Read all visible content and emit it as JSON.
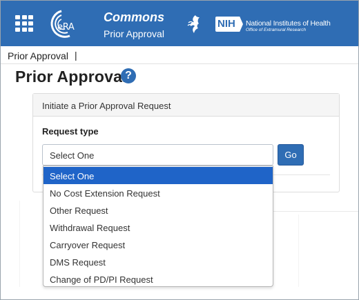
{
  "header": {
    "logo_text": "eRA",
    "app_title": "Commons",
    "app_subtitle": "Prior Approval",
    "nih_badge": "NIH",
    "nih_name": "National Institutes of Health",
    "nih_sub": "Office of Extramural Research",
    "brand_color": "#2f6db4"
  },
  "breadcrumb": {
    "label": "Prior Approval",
    "separator": "|"
  },
  "page": {
    "title": "Prior Approval",
    "help_symbol": "?"
  },
  "panel": {
    "heading": "Initiate a Prior Approval Request",
    "field_label": "Request type",
    "select_value": "Select One",
    "go_label": "Go"
  },
  "dropdown": {
    "options": [
      "Select One",
      "No Cost Extension Request",
      "Other Request",
      "Withdrawal Request",
      "Carryover Request",
      "DMS Request",
      "Change of PD/PI Request"
    ],
    "highlighted": "Select One",
    "highlight_color": "#1f64c8"
  }
}
